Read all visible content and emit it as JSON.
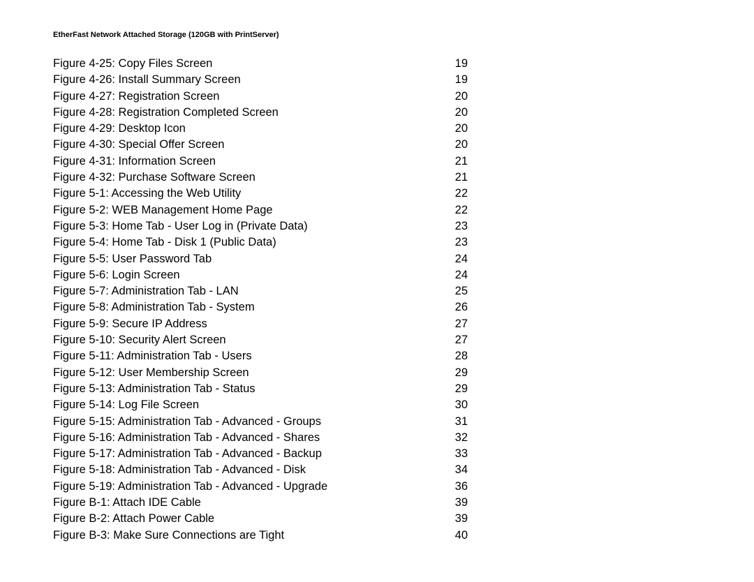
{
  "header": "EtherFast Network Attached Storage (120GB with PrintServer)",
  "entries": [
    {
      "label": "Figure 4-25: Copy Files Screen",
      "page": "19"
    },
    {
      "label": "Figure 4-26: Install Summary Screen",
      "page": "19"
    },
    {
      "label": "Figure 4-27: Registration Screen",
      "page": "20"
    },
    {
      "label": "Figure 4-28: Registration Completed Screen",
      "page": "20"
    },
    {
      "label": "Figure 4-29: Desktop Icon",
      "page": "20"
    },
    {
      "label": "Figure 4-30: Special Offer Screen",
      "page": "20"
    },
    {
      "label": "Figure 4-31: Information Screen",
      "page": "21"
    },
    {
      "label": "Figure 4-32: Purchase Software Screen",
      "page": "21"
    },
    {
      "label": "Figure 5-1: Accessing the Web Utility",
      "page": "22"
    },
    {
      "label": "Figure 5-2: WEB Management Home Page",
      "page": "22"
    },
    {
      "label": "Figure 5-3: Home Tab - User Log in (Private Data)",
      "page": "23"
    },
    {
      "label": "Figure 5-4: Home Tab - Disk 1 (Public Data)",
      "page": "23"
    },
    {
      "label": "Figure 5-5: User Password Tab",
      "page": "24"
    },
    {
      "label": "Figure 5-6: Login Screen",
      "page": "24"
    },
    {
      "label": "Figure 5-7: Administration Tab - LAN",
      "page": "25"
    },
    {
      "label": "Figure 5-8: Administration Tab - System",
      "page": "26"
    },
    {
      "label": "Figure 5-9: Secure IP Address",
      "page": "27"
    },
    {
      "label": "Figure 5-10: Security Alert Screen",
      "page": "27"
    },
    {
      "label": "Figure 5-11: Administration Tab - Users",
      "page": "28"
    },
    {
      "label": "Figure 5-12: User Membership Screen",
      "page": "29"
    },
    {
      "label": "Figure 5-13: Administration Tab - Status",
      "page": "29"
    },
    {
      "label": "Figure 5-14: Log File Screen",
      "page": "30"
    },
    {
      "label": "Figure 5-15: Administration Tab - Advanced - Groups",
      "page": "31"
    },
    {
      "label": "Figure 5-16: Administration Tab - Advanced - Shares",
      "page": "32"
    },
    {
      "label": "Figure 5-17: Administration Tab - Advanced - Backup",
      "page": "33"
    },
    {
      "label": "Figure 5-18: Administration Tab - Advanced - Disk",
      "page": "34"
    },
    {
      "label": "Figure 5-19: Administration Tab - Advanced - Upgrade",
      "page": "36"
    },
    {
      "label": "Figure B-1: Attach IDE Cable",
      "page": "39"
    },
    {
      "label": "Figure B-2: Attach Power Cable",
      "page": "39"
    },
    {
      "label": "Figure B-3: Make Sure Connections are Tight",
      "page": "40"
    }
  ]
}
